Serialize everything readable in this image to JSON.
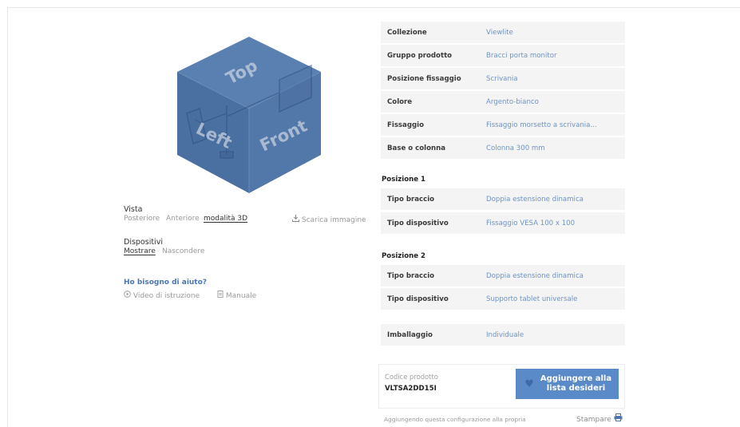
{
  "cube": {
    "face_top": "Top",
    "face_left": "Left",
    "face_front": "Front",
    "color": "#4f76a8"
  },
  "view": {
    "label": "Vista",
    "options": [
      "Posteriore",
      "Anteriore",
      "modalità 3D"
    ],
    "active": "modalità 3D",
    "download": "Scarica immagine",
    "download_icon": "download-icon"
  },
  "devices": {
    "label": "Dispositivi",
    "options": [
      "Mostrare",
      "Nascondere"
    ],
    "active": "Mostrare"
  },
  "help": {
    "title": "Ho bisogno di aiuto?",
    "video": "Video di istruzione",
    "video_icon": "play-circle-icon",
    "manual": "Manuale",
    "manual_icon": "document-icon"
  },
  "specs": [
    {
      "key": "Collezione",
      "value": "Viewlite"
    },
    {
      "key": "Gruppo prodotto",
      "value": "Bracci porta monitor"
    },
    {
      "key": "Posizione fissaggio",
      "value": "Scrivania"
    },
    {
      "key": "Colore",
      "value": "Argento-bianco"
    },
    {
      "key": "Fissaggio",
      "value": "Fissaggio morsetto a scrivania..."
    },
    {
      "key": "Base o colonna",
      "value": "Colonna 300 mm"
    }
  ],
  "position1": {
    "title": "Posizione 1",
    "rows": [
      {
        "key": "Tipo braccio",
        "value": "Doppia estensione dinamica"
      },
      {
        "key": "Tipo dispositivo",
        "value": "Fissaggio VESA 100 x 100"
      }
    ]
  },
  "position2": {
    "title": "Posizione 2",
    "rows": [
      {
        "key": "Tipo braccio",
        "value": "Doppia estensione dinamica"
      },
      {
        "key": "Tipo dispositivo",
        "value": "Supporto tablet universale"
      }
    ]
  },
  "packaging": {
    "key": "Imballaggio",
    "value": "Individuale"
  },
  "product": {
    "code_label": "Codice prodotto",
    "code": "VLTSA2DD15I",
    "wishlist_line1": "Aggiungere alla",
    "wishlist_line2": "lista desideri",
    "wishlist_icon": "heart-icon",
    "accent": "#5b8ac9"
  },
  "footer": {
    "note": "Aggiungendo questa configurazione alla propria",
    "print": "Stampare",
    "print_icon": "printer-icon"
  }
}
